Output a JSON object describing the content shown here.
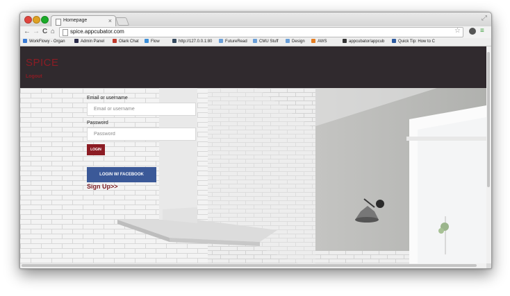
{
  "browser": {
    "tab": {
      "title": "Homepage",
      "close": "×"
    },
    "nav": {
      "back": "←",
      "forward": "→",
      "reload": "C",
      "home": "⌂"
    },
    "url": "spice.appcubator.com",
    "bookmarks": [
      {
        "label": "WorkFlowy - Organ",
        "color": "#3a7bd5"
      },
      {
        "label": "Admin Panel",
        "color": "#2b2b4a"
      },
      {
        "label": "Olark Chat",
        "color": "#c0392b"
      },
      {
        "label": "Flow",
        "color": "#3b8fd9"
      },
      {
        "label": "http://127.0.0.1:80",
        "color": "#34495e"
      },
      {
        "label": "FutureRead",
        "color": "#6a9fd8"
      },
      {
        "label": "CMU Stuff",
        "color": "#6a9fd8"
      },
      {
        "label": "Design",
        "color": "#6a9fd8"
      },
      {
        "label": "AWS",
        "color": "#e67e22"
      },
      {
        "label": "appcubator/appcub",
        "color": "#333333"
      },
      {
        "label": "Quick Tip: How to C",
        "color": "#2c5aa0"
      }
    ]
  },
  "site": {
    "brand": "SPICE",
    "logout": "Logout",
    "login_form": {
      "username_label": "Email or username",
      "username_placeholder": "Email or username",
      "password_label": "Password",
      "password_placeholder": "Password",
      "login_button": "LOGIN",
      "facebook_button": "LOGIN W/ FACEBOOK",
      "signup_link": "Sign Up>>"
    }
  },
  "colors": {
    "header_bg": "#302a2e",
    "brand": "#8c1c24",
    "facebook": "#3b5998"
  }
}
